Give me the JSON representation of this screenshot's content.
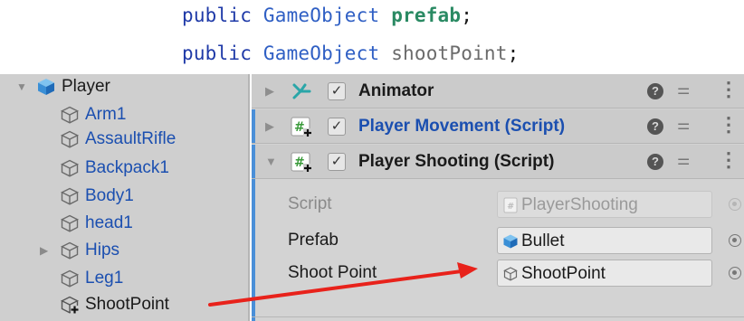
{
  "code": {
    "line1": {
      "kw": "public",
      "type": "GameObject",
      "ident": "prefab",
      "end": ";"
    },
    "line2": {
      "kw": "public",
      "type": "GameObject",
      "ident": "shootPoint",
      "end": ";"
    }
  },
  "hierarchy": {
    "root": {
      "label": "Player",
      "icon": "prefab-cube-icon",
      "expanded": true
    },
    "children": [
      {
        "label": "Arm1",
        "icon": "gameobject-cube-icon",
        "expandable": false
      },
      {
        "label": "AssaultRifle",
        "icon": "gameobject-cube-icon",
        "expandable": false
      },
      {
        "label": "Backpack1",
        "icon": "gameobject-cube-icon",
        "expandable": false
      },
      {
        "label": "Body1",
        "icon": "gameobject-cube-icon",
        "expandable": false
      },
      {
        "label": "head1",
        "icon": "gameobject-cube-icon",
        "expandable": false
      },
      {
        "label": "Hips",
        "icon": "gameobject-cube-icon",
        "expandable": true
      },
      {
        "label": "Leg1",
        "icon": "gameobject-cube-icon",
        "expandable": false
      },
      {
        "label": "ShootPoint",
        "icon": "gameobject-added-icon",
        "expandable": false
      }
    ]
  },
  "inspector": {
    "components": [
      {
        "title": "Animator",
        "icon": "animator-icon",
        "checked": true,
        "expanded": false
      },
      {
        "title": "Player Movement (Script)",
        "icon": "csharp-script-icon",
        "checked": true,
        "expanded": false
      },
      {
        "title": "Player Shooting (Script)",
        "icon": "csharp-script-icon",
        "checked": true,
        "expanded": true
      }
    ],
    "check_glyph": "✓",
    "help_glyph": "?",
    "fields": [
      {
        "label": "Script",
        "value": "PlayerShooting",
        "icon": "script-file-icon",
        "readonly": true
      },
      {
        "label": "Prefab",
        "value": "Bullet",
        "icon": "prefab-cube-icon",
        "readonly": false
      },
      {
        "label": "Shoot Point",
        "value": "ShootPoint",
        "icon": "gameobject-cube-icon",
        "readonly": false
      }
    ]
  },
  "colors": {
    "arrow": "#e8221b",
    "blue_text": "#1b4fb0",
    "accent_bar": "#4a8fd8"
  }
}
